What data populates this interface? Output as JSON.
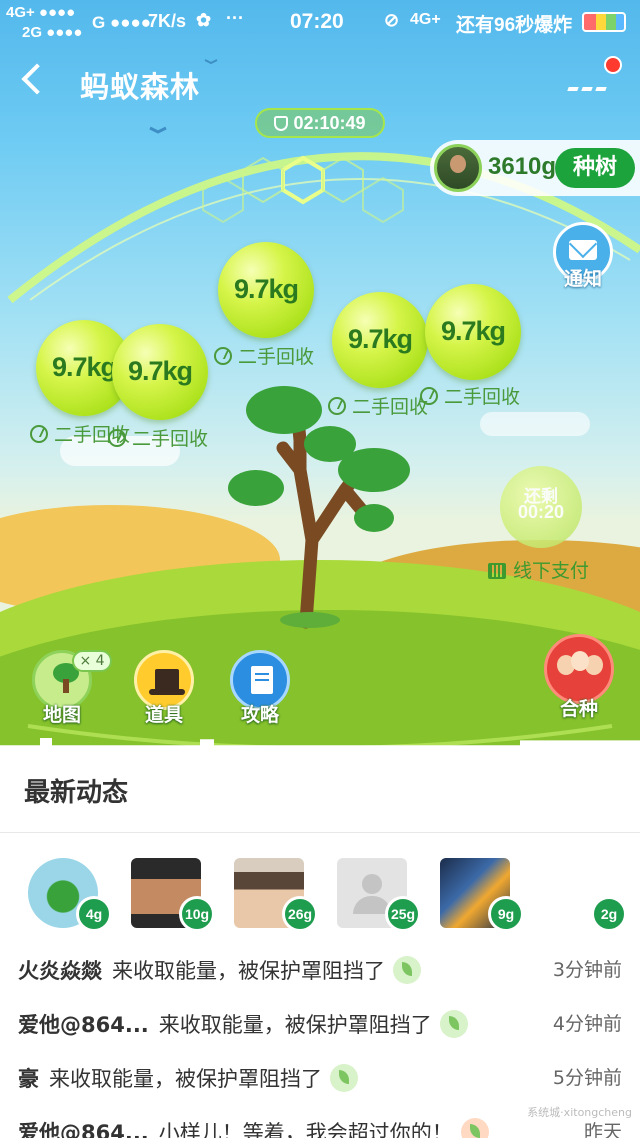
{
  "status_bar": {
    "sig1": "4G+ ●●●●",
    "sig2": "2G ●●●●",
    "sig3": "G ●●●●",
    "speed": "7K/s",
    "time": "07:20",
    "network": "4G+",
    "countdown": "还有96秒爆炸"
  },
  "header": {
    "title": "蚂蚁森林"
  },
  "shield_timer": "02:10:49",
  "user": {
    "energy": "3610g",
    "plant_button": "种树"
  },
  "notice_label": "通知",
  "bubbles": [
    {
      "amount": "9.7kg",
      "label": "二手回收"
    },
    {
      "amount": "9.7kg",
      "label": "二手回收"
    },
    {
      "amount": "9.7kg",
      "label": "二手回收"
    },
    {
      "amount": "9.7kg",
      "label": "二手回收"
    },
    {
      "amount": "9.7kg",
      "label": "二手回收"
    }
  ],
  "pending": {
    "line1": "还剩",
    "line2": "00:20",
    "label": "线下支付"
  },
  "tools": {
    "map": "地图",
    "map_badge": "× 4",
    "props": "道具",
    "guide": "攻略",
    "cooperative": "合种"
  },
  "feed": {
    "title": "最新动态",
    "friends": [
      {
        "energy": "4g",
        "color": "#9ad6e8"
      },
      {
        "energy": "10g",
        "color": "#3e3b38"
      },
      {
        "energy": "26g",
        "color": "#b7a58f"
      },
      {
        "energy": "25g",
        "color": "#e3e3e3"
      },
      {
        "energy": "9g",
        "color": "#2c4d7a"
      },
      {
        "energy": "2g",
        "color": "#ffffff"
      }
    ],
    "rows": [
      {
        "name": "火炎焱燚",
        "message": "来收取能量，被保护罩阻挡了",
        "time": "3分钟前"
      },
      {
        "name": "爱他@864...",
        "message": "来收取能量，被保护罩阻挡了",
        "time": "4分钟前"
      },
      {
        "name": "豪",
        "message": "来收取能量，被保护罩阻挡了",
        "time": "5分钟前"
      },
      {
        "name": "爱他@864...",
        "message": "小样儿！等着，我会超过你的！",
        "time": "昨天"
      }
    ]
  },
  "watermark": "系统城·xitongcheng"
}
